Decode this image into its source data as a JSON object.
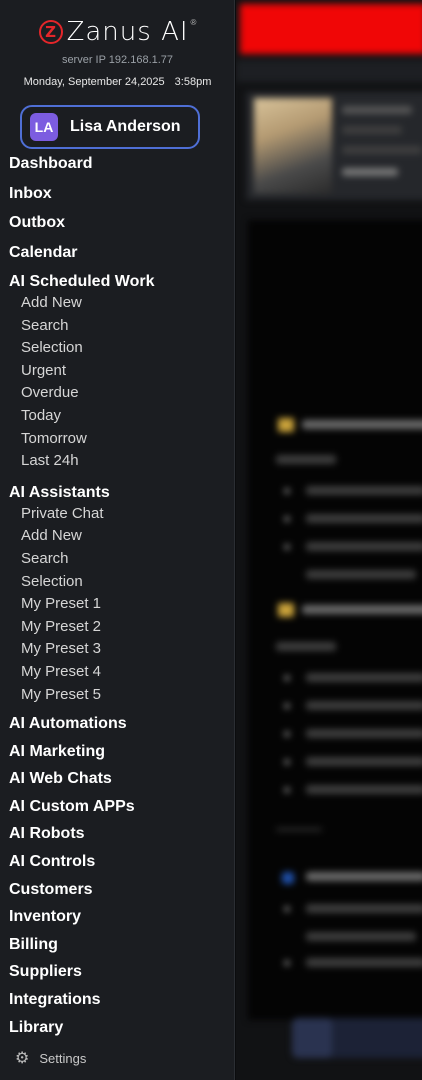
{
  "brand": {
    "logo_letter": "Z",
    "name": "Zanus AI",
    "reg": "®"
  },
  "server_ip": "server IP 192.168.1.77",
  "date": "Monday, September 24,2025",
  "time": "3:58pm",
  "user": {
    "initials": "LA",
    "name": "Lisa Anderson"
  },
  "nav": {
    "dashboard": "Dashboard",
    "inbox": "Inbox",
    "outbox": "Outbox",
    "calendar": "Calendar",
    "ai_scheduled_work": {
      "label": "AI Scheduled Work",
      "items": [
        "Add New",
        "Search",
        "Selection",
        "Urgent",
        "Overdue",
        "Today",
        "Tomorrow",
        "Last 24h"
      ]
    },
    "ai_assistants": {
      "label": "AI Assistants",
      "items": [
        "Private Chat",
        "Add New",
        "Search",
        "Selection",
        "My Preset 1",
        "My Preset 2",
        "My Preset 3",
        "My Preset 4",
        "My Preset 5"
      ]
    },
    "ai_automations": "AI Automations",
    "ai_marketing": "AI Marketing",
    "ai_web_chats": "AI Web Chats",
    "ai_custom_apps": "AI Custom APPs",
    "ai_robots": "AI Robots",
    "ai_controls": "AI Controls",
    "customers": "Customers",
    "inventory": "Inventory",
    "billing": "Billing",
    "suppliers": "Suppliers",
    "integrations": "Integrations",
    "library": "Library"
  },
  "settings": {
    "label": "Settings",
    "icon": "gear-icon"
  },
  "colors": {
    "sidebar_bg": "#1b1d21",
    "accent_border": "#4f6fd6",
    "avatar_bg": "#7c5ce0",
    "alert_red": "#f00606",
    "logo_red": "#e4262a"
  }
}
